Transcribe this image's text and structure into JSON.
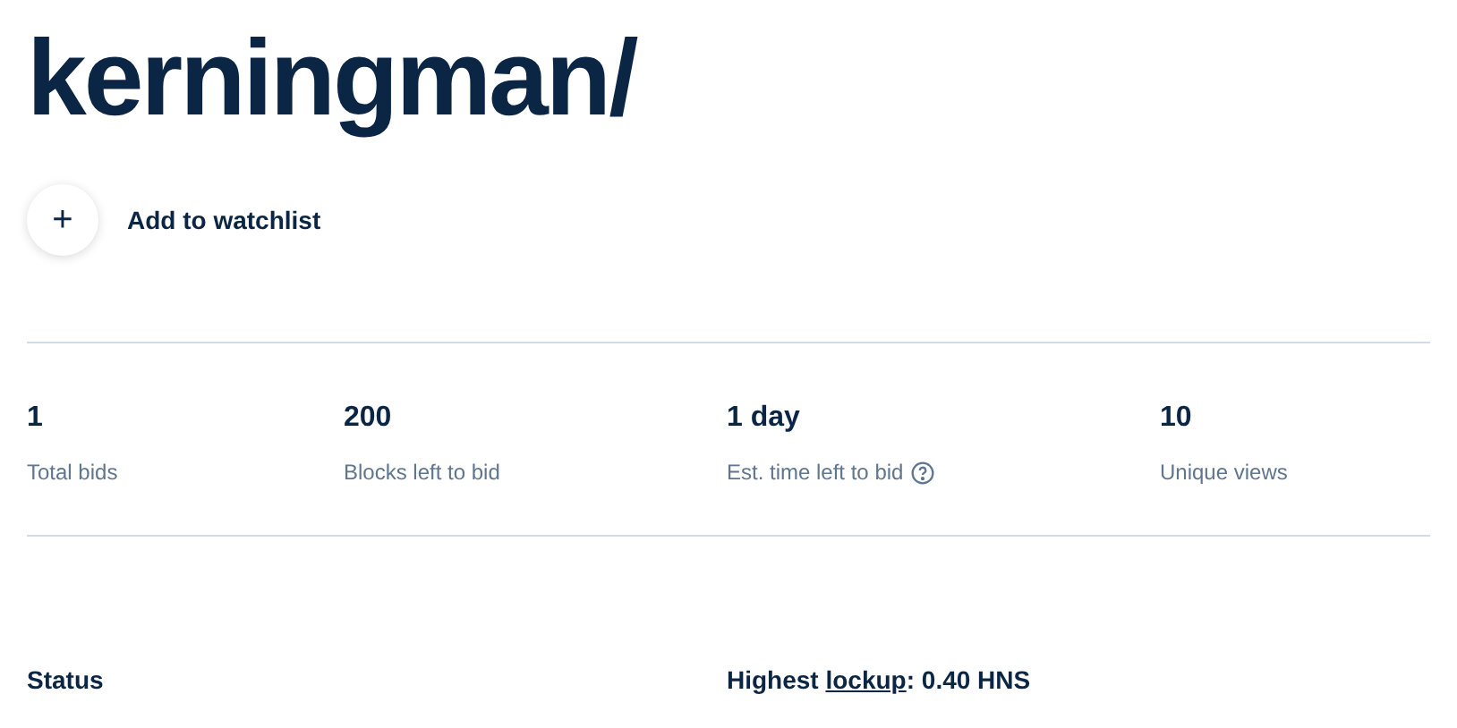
{
  "title": "kerningman/",
  "watchlist": {
    "icon_text": "+",
    "label": "Add to watchlist"
  },
  "stats": [
    {
      "value": "1",
      "label": "Total bids",
      "help": false
    },
    {
      "value": "200",
      "label": "Blocks left to bid",
      "help": false
    },
    {
      "value": "1 day",
      "label": "Est. time left to bid",
      "help": true
    },
    {
      "value": "10",
      "label": "Unique views",
      "help": false
    }
  ],
  "status": {
    "label": "Status"
  },
  "highest": {
    "before": "Highest ",
    "link": "lockup",
    "after": ": 0.40 HNS"
  }
}
